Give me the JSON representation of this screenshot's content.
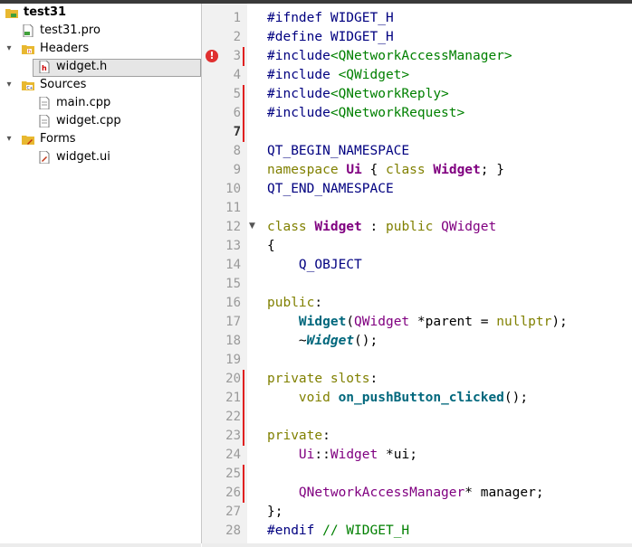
{
  "tree": {
    "project": "test31",
    "pro_file": "test31.pro",
    "headers_folder": "Headers",
    "header_file": "widget.h",
    "sources_folder": "Sources",
    "source_main": "main.cpp",
    "source_widget": "widget.cpp",
    "forms_folder": "Forms",
    "form_file": "widget.ui"
  },
  "editor": {
    "line_numbers": [
      "1",
      "2",
      "3",
      "4",
      "5",
      "6",
      "7",
      "8",
      "9",
      "10",
      "11",
      "12",
      "13",
      "14",
      "15",
      "16",
      "17",
      "18",
      "19",
      "20",
      "21",
      "22",
      "23",
      "24",
      "25",
      "26",
      "27",
      "28"
    ],
    "lines": {
      "l1": [
        "#ifndef WIDGET_H"
      ],
      "l2": [
        "#define WIDGET_H"
      ],
      "l3": [
        "#include",
        "<QNetworkAccessManager>"
      ],
      "l4": [
        "#include ",
        "<QWidget>"
      ],
      "l5": [
        "#include",
        "<QNetworkReply>"
      ],
      "l6": [
        "#include",
        "<QNetworkRequest>"
      ],
      "l8": [
        "QT_BEGIN_NAMESPACE"
      ],
      "l9": [
        "namespace",
        " ",
        "Ui",
        " { ",
        "class",
        " ",
        "Widget",
        "; }"
      ],
      "l10": [
        "QT_END_NAMESPACE"
      ],
      "l12": [
        "class",
        " ",
        "Widget",
        " : ",
        "public",
        " ",
        "QWidget"
      ],
      "l13": [
        "{"
      ],
      "l14": [
        "    ",
        "Q_OBJECT"
      ],
      "l16": [
        "public",
        ":"
      ],
      "l17": [
        "    ",
        "Widget",
        "(",
        "QWidget",
        " *",
        "parent",
        " = ",
        "nullptr",
        ");"
      ],
      "l18": [
        "    ~",
        "Widget",
        "();"
      ],
      "l20": [
        "private",
        " ",
        "slots",
        ":"
      ],
      "l21": [
        "    ",
        "void",
        " ",
        "on_pushButton_clicked",
        "();"
      ],
      "l23": [
        "private",
        ":"
      ],
      "l24": [
        "    ",
        "Ui",
        "::",
        "Widget",
        " *",
        "ui",
        ";"
      ],
      "l26": [
        "    ",
        "QNetworkAccessManager",
        "* ",
        "manager",
        ";"
      ],
      "l27": [
        "};"
      ],
      "l28": [
        "#endif",
        " // WIDGET_H"
      ]
    },
    "error_icon": "error-icon"
  }
}
